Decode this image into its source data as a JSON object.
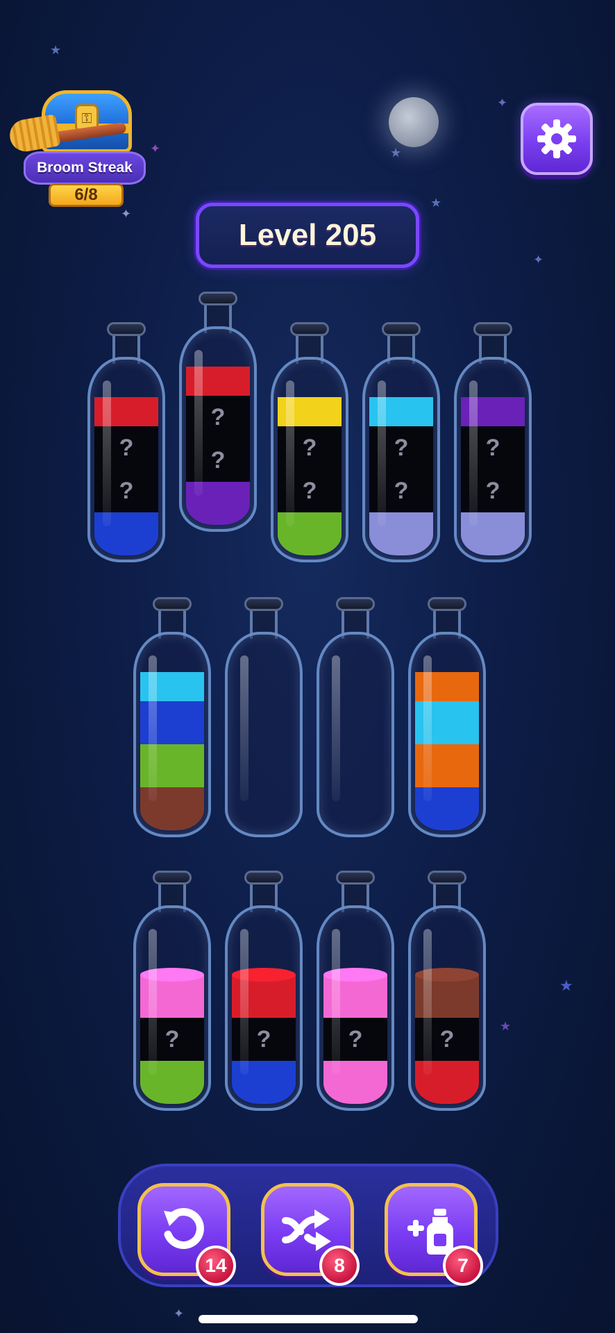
{
  "streak": {
    "label": "Broom Streak",
    "count": "6/8"
  },
  "level": {
    "label": "Level 205"
  },
  "settings": {
    "icon": "gear-icon"
  },
  "colors": {
    "red": "#d81d2a",
    "blue": "#1c3fd2",
    "purple": "#6a21b8",
    "yellow": "#f2d21a",
    "green": "#69b52a",
    "cyan": "#29c3ef",
    "lavender": "#8a8ed8",
    "brown": "#7c3a2c",
    "orange": "#e8680e",
    "pink": "#f468d4",
    "hidden": "#06070d"
  },
  "hidden_mark": "?",
  "bottles": [
    {
      "id": "r1b1",
      "layers_top_to_bottom": [
        "red",
        "hidden",
        "hidden",
        "blue"
      ]
    },
    {
      "id": "r1b2",
      "layers_top_to_bottom": [
        "red",
        "hidden",
        "hidden",
        "purple"
      ],
      "selected": true
    },
    {
      "id": "r1b3",
      "layers_top_to_bottom": [
        "yellow",
        "hidden",
        "hidden",
        "green"
      ]
    },
    {
      "id": "r1b4",
      "layers_top_to_bottom": [
        "cyan",
        "hidden",
        "hidden",
        "lavender"
      ]
    },
    {
      "id": "r1b5",
      "layers_top_to_bottom": [
        "purple",
        "hidden",
        "hidden",
        "lavender"
      ]
    },
    {
      "id": "r2b1",
      "layers_top_to_bottom": [
        "cyan",
        "blue",
        "green",
        "brown"
      ]
    },
    {
      "id": "r2b2",
      "layers_top_to_bottom": []
    },
    {
      "id": "r2b3",
      "layers_top_to_bottom": []
    },
    {
      "id": "r2b4",
      "layers_top_to_bottom": [
        "orange",
        "cyan",
        "orange",
        "blue"
      ]
    },
    {
      "id": "r3b1",
      "layers_top_to_bottom": [
        "pink",
        "hidden",
        "green"
      ]
    },
    {
      "id": "r3b2",
      "layers_top_to_bottom": [
        "red",
        "hidden",
        "blue"
      ]
    },
    {
      "id": "r3b3",
      "layers_top_to_bottom": [
        "pink",
        "hidden",
        "pink"
      ]
    },
    {
      "id": "r3b4",
      "layers_top_to_bottom": [
        "brown",
        "hidden",
        "red"
      ]
    }
  ],
  "tools": [
    {
      "name": "undo",
      "icon": "undo-icon",
      "count": "14"
    },
    {
      "name": "shuffle",
      "icon": "shuffle-icon",
      "count": "8"
    },
    {
      "name": "add-bottle",
      "icon": "add-bottle-icon",
      "count": "7"
    }
  ]
}
